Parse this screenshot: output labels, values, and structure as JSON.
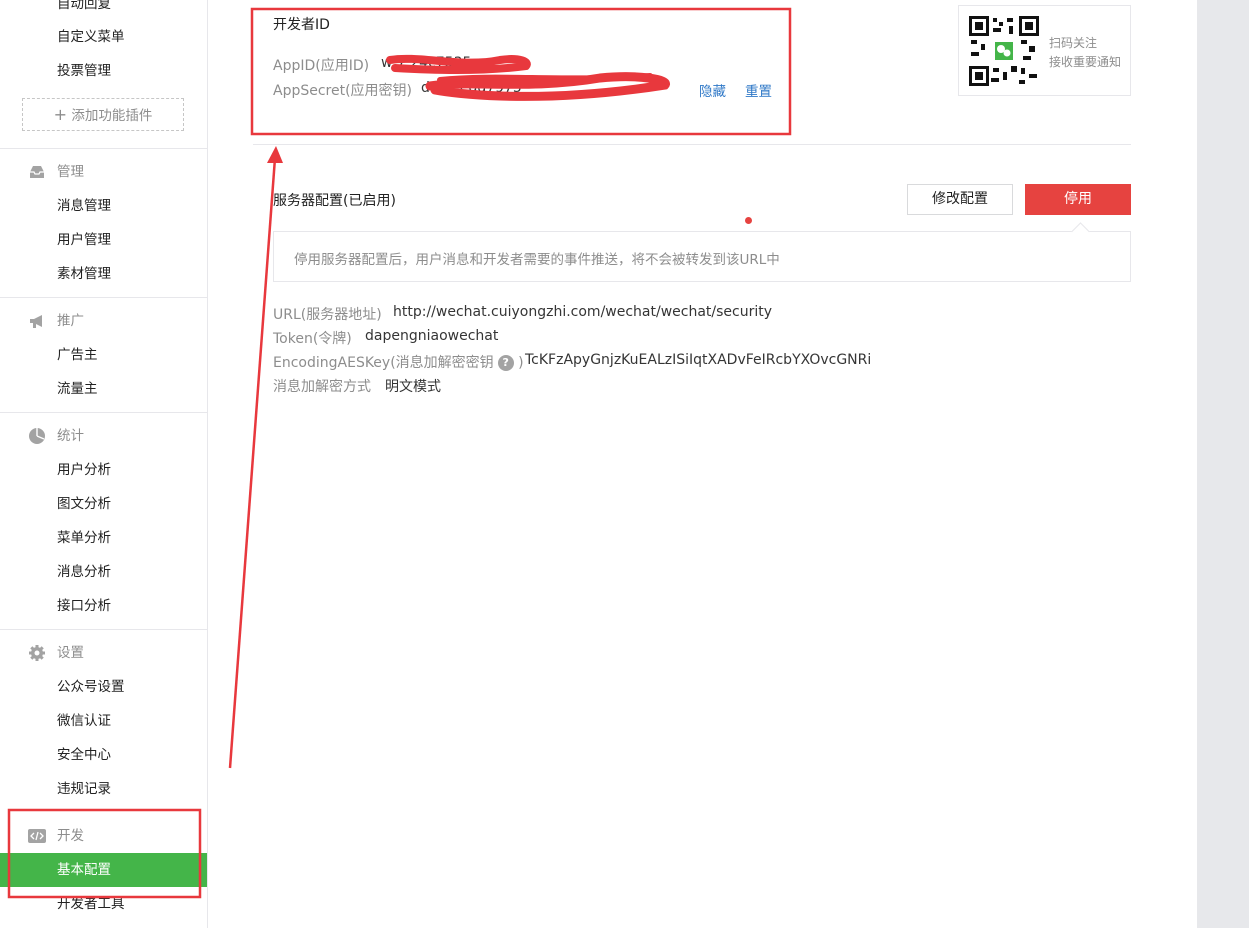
{
  "sidebar": {
    "top_items": [
      "自动回复",
      "自定义菜单",
      "投票管理"
    ],
    "add_plugin": "添加功能插件",
    "sections": [
      {
        "title": "管理",
        "icon": "inbox-icon",
        "items": [
          "消息管理",
          "用户管理",
          "素材管理"
        ]
      },
      {
        "title": "推广",
        "icon": "megaphone-icon",
        "items": [
          "广告主",
          "流量主"
        ]
      },
      {
        "title": "统计",
        "icon": "pie-chart-icon",
        "items": [
          "用户分析",
          "图文分析",
          "菜单分析",
          "消息分析",
          "接口分析"
        ]
      },
      {
        "title": "设置",
        "icon": "gear-icon",
        "items": [
          "公众号设置",
          "微信认证",
          "安全中心",
          "违规记录"
        ]
      },
      {
        "title": "开发",
        "icon": "code-icon",
        "items": [
          "基本配置",
          "开发者工具"
        ],
        "active_item": "基本配置"
      }
    ]
  },
  "developer": {
    "title": "开发者ID",
    "appid_label": "AppID(应用ID)",
    "appid_value": "w 7                   24c7535",
    "secret_label": "AppSecret(应用密钥)",
    "secret_value": "d5                            bcedd7975",
    "hide_link": "隐藏",
    "reset_link": "重置"
  },
  "qr": {
    "line1": "扫码关注",
    "line2": "接收重要通知"
  },
  "server": {
    "title": "服务器配置(已启用)",
    "modify_button": "修改配置",
    "stop_button": "停用",
    "tip": "停用服务器配置后，用户消息和开发者需要的事件推送，将不会被转发到该URL中",
    "url_label": "URL(服务器地址)",
    "url_value": "http://wechat.cuiyongzhi.com/wechat/wechat/security",
    "token_label": "Token(令牌)",
    "token_value": "dapengniaowechat",
    "aes_label": "EncodingAESKey(消息加解密密钥",
    "aes_close": ")",
    "aes_value": "TcKFzApyGnjzKuEALzISiIqtXADvFeIRcbYXOvcGNRi",
    "mode_label": "消息加解密方式",
    "mode_value": "明文模式"
  },
  "colors": {
    "accent_green": "#44b549",
    "danger_red": "#e64340",
    "link_blue": "#2f78c7",
    "annotation_red": "#e8383d"
  }
}
